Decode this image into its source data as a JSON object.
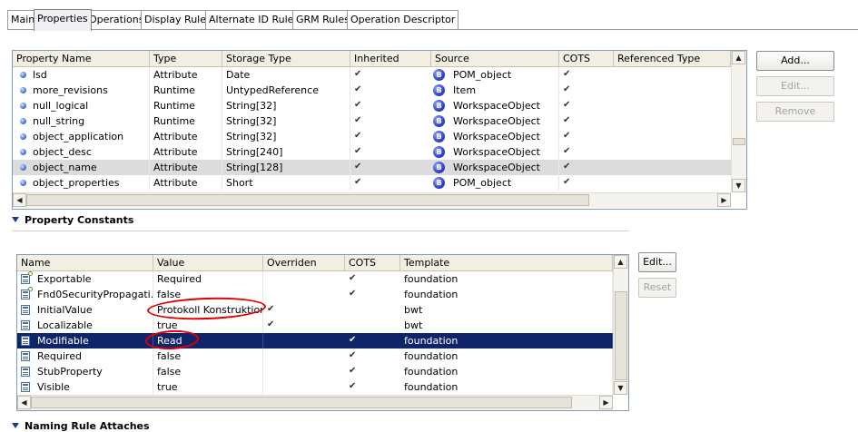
{
  "tabs": [
    "Main",
    "Properties",
    "Operations",
    "Display Rules",
    "Alternate ID Rules",
    "GRM Rules",
    "Operation Descriptor"
  ],
  "active_tab": "Properties",
  "properties_table": {
    "columns": [
      "Property Name",
      "Type",
      "Storage Type",
      "Inherited",
      "Source",
      "COTS",
      "Referenced Type"
    ],
    "rows": [
      {
        "name": "lsd",
        "type": "Attribute",
        "storage": "Date",
        "inherited": "✔",
        "source": "POM_object",
        "cots": "✔"
      },
      {
        "name": "more_revisions",
        "type": "Runtime",
        "storage": "UntypedReference",
        "inherited": "✔",
        "source": "Item",
        "cots": "✔"
      },
      {
        "name": "null_logical",
        "type": "Runtime",
        "storage": "String[32]",
        "inherited": "✔",
        "source": "WorkspaceObject",
        "cots": "✔"
      },
      {
        "name": "null_string",
        "type": "Runtime",
        "storage": "String[32]",
        "inherited": "✔",
        "source": "WorkspaceObject",
        "cots": "✔"
      },
      {
        "name": "object_application",
        "type": "Attribute",
        "storage": "String[32]",
        "inherited": "✔",
        "source": "WorkspaceObject",
        "cots": "✔"
      },
      {
        "name": "object_desc",
        "type": "Attribute",
        "storage": "String[240]",
        "inherited": "✔",
        "source": "WorkspaceObject",
        "cots": "✔"
      },
      {
        "name": "object_name",
        "type": "Attribute",
        "storage": "String[128]",
        "inherited": "✔",
        "source": "WorkspaceObject",
        "cots": "✔"
      },
      {
        "name": "object_properties",
        "type": "Attribute",
        "storage": "Short",
        "inherited": "✔",
        "source": "POM_object",
        "cots": "✔"
      }
    ],
    "source_icon_letter": "B",
    "buttons": {
      "add": "Add...",
      "edit": "Edit...",
      "remove": "Remove"
    }
  },
  "property_constants": {
    "section_title": "Property Constants",
    "columns": [
      "Name",
      "Value",
      "Overriden",
      "COTS",
      "Template"
    ],
    "rows": [
      {
        "name": "Exportable",
        "value": "Required",
        "overriden": "",
        "cots": "✔",
        "template": "foundation"
      },
      {
        "name": "Fnd0SecurityPropagati...",
        "value": "false",
        "overriden": "",
        "cots": "✔",
        "template": "foundation"
      },
      {
        "name": "InitialValue",
        "value": "Protokoll Konstruktion",
        "overriden": "✔",
        "cots": "",
        "template": "bwt"
      },
      {
        "name": "Localizable",
        "value": "true",
        "overriden": "✔",
        "cots": "",
        "template": "bwt"
      },
      {
        "name": "Modifiable",
        "value": "Read",
        "overriden": "",
        "cots": "✔",
        "template": "foundation"
      },
      {
        "name": "Required",
        "value": "false",
        "overriden": "",
        "cots": "✔",
        "template": "foundation"
      },
      {
        "name": "StubProperty",
        "value": "false",
        "overriden": "",
        "cots": "✔",
        "template": "foundation"
      },
      {
        "name": "Visible",
        "value": "true",
        "overriden": "",
        "cots": "✔",
        "template": "foundation"
      }
    ],
    "buttons": {
      "edit": "Edit...",
      "reset": "Reset"
    }
  },
  "naming_rule_section": "Naming Rule Attaches",
  "colors": {
    "selection_navy": "#10246a",
    "selection_grey": "#dcdcdc",
    "annotation": "#e00000",
    "section_triangle": "#1a3d8a"
  }
}
